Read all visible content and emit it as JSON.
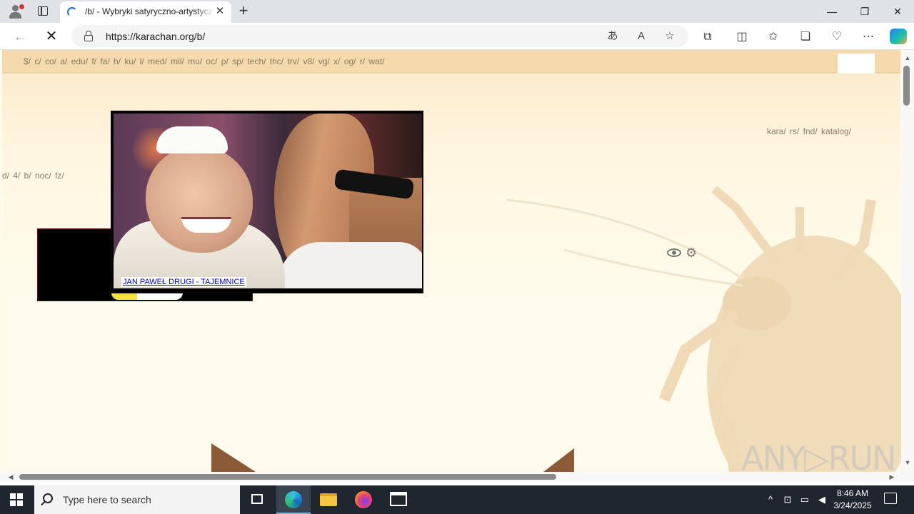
{
  "browser": {
    "tab_title": "/b/ - Wybryki satyryczno-artystyczne",
    "url": "https://karachan.org/b/",
    "icons": [
      "profile-icon",
      "tab-actions-icon",
      "close-icon",
      "new-tab-icon",
      "back-icon",
      "stop-icon",
      "lock-icon",
      "translate-icon",
      "read-aloud-icon",
      "favorite-icon",
      "extensions-icon",
      "split-screen-icon",
      "favorites-icon",
      "collections-icon",
      "browser-essentials-icon",
      "more-icon",
      "copilot-icon"
    ]
  },
  "page": {
    "top_nav_links": "$/  c/  co/  a/  edu/  f/  fa/  h/  ku/  l/  med/  mil/  mu/  oc/  p/  sp/  tech/  thc/  trv/  v8/  vg/  x/  og/  r/  wat/",
    "right_links": "kara/  rs/  fnd/  katalog/",
    "left_links": "d/  4/  b/  noc/  fz/",
    "popup_caption": "JAN PAWEŁ DRUGI - TAJEMNICE",
    "watermark": "ANY▷RUN",
    "accent_color": "#8b5a36",
    "nav_bg_color": "#f3d9ac"
  },
  "taskbar": {
    "search_placeholder": "Type here to search",
    "time": "8:46 AM",
    "date": "3/24/2025"
  }
}
